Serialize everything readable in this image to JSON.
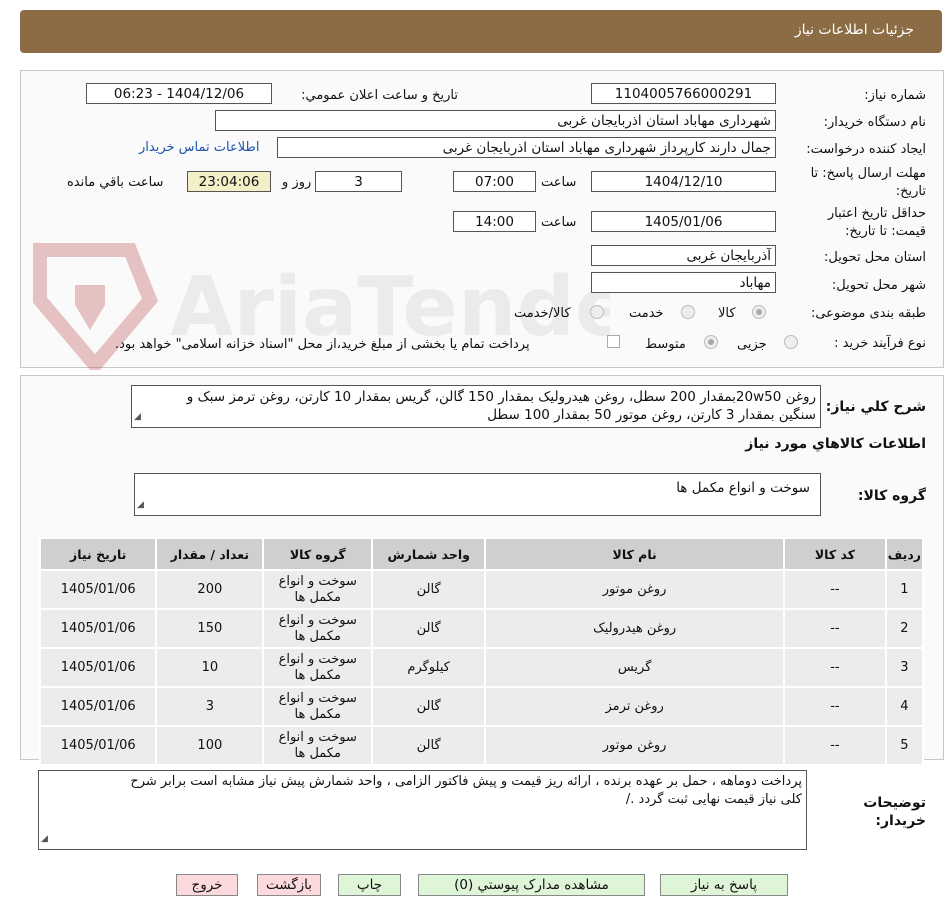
{
  "header": {
    "title": "جزئیات اطلاعات نیاز"
  },
  "watermark": "AriaTender.neT",
  "form": {
    "need_number_label": "شماره نیاز:",
    "need_number": "1104005766000291",
    "announce_label": "تاریخ و ساعت اعلان عمومي:",
    "announce_value": "1404/12/06 - 06:23",
    "buyer_org_label": "نام دستگاه خریدار:",
    "buyer_org": "شهرداری مهاباد استان اذربایجان غربی",
    "requester_label": "ایجاد کننده درخواست:",
    "requester": "جمال دارند کارپرداز  شهرداری مهاباد استان اذربایجان غربی",
    "contact_link": "اطلاعات تماس خریدار",
    "deadline_label_1": "مهلت ارسال پاسخ: تا",
    "deadline_label_2": "تاریخ:",
    "deadline_date": "1404/12/10",
    "time_label": "ساعت",
    "deadline_time": "07:00",
    "days_value": "3",
    "days_label": "روز و",
    "remaining_time": "23:04:06",
    "remaining_label": "ساعت باقي مانده",
    "validity_label_1": "حداقل تاريخ اعتبار",
    "validity_label_2": "قيمت: تا تاريخ:",
    "validity_date": "1405/01/06",
    "validity_time": "14:00",
    "province_label": "استان محل تحویل:",
    "province": "آذربایجان غربی",
    "city_label": "شهر محل تحویل:",
    "city": "مهاباد",
    "category_label": "طبقه بندی موضوعی:",
    "category_options": [
      "کالا",
      "خدمت",
      "کالا/خدمت"
    ],
    "process_label": "نوع فرآیند خرید :",
    "process_options": [
      "جزیی",
      "متوسط"
    ],
    "payment_note": "پرداخت تمام یا بخشی از مبلغ خرید،از محل \"اسناد خزانه اسلامی\" خواهد بود."
  },
  "summary": {
    "label": "شرح کلي نياز:",
    "line1": "روغن 20w50بمقدار 200 سطل، روغن هیدرولیک بمقدار 150 گالن، گریس بمقدار 10 کارتن، روغن ترمز سبک و",
    "line2": "سنگین بمقدار 3 کارتن، روغن موتور 50 بمقدار 100 سطل"
  },
  "goods": {
    "section_title": "اطلاعات کالاهاي مورد نياز",
    "group_label": "گروه کالا:",
    "group_value": "سوخت و انواع مکمل ها",
    "columns": [
      "رديف",
      "کد کالا",
      "نام کالا",
      "واحد شمارش",
      "گروه کالا",
      "تعداد / مقدار",
      "تاريخ نياز"
    ],
    "rows": [
      {
        "idx": "1",
        "code": "--",
        "name": "روغن موتور",
        "unit": "گالن",
        "group_1": "سوخت و انواع",
        "group_2": "مکمل ها",
        "qty": "200",
        "date": "1405/01/06"
      },
      {
        "idx": "2",
        "code": "--",
        "name": "روغن هیدرولیک",
        "unit": "گالن",
        "group_1": "سوخت و انواع",
        "group_2": "مکمل ها",
        "qty": "150",
        "date": "1405/01/06"
      },
      {
        "idx": "3",
        "code": "--",
        "name": "گریس",
        "unit": "کیلوگرم",
        "group_1": "سوخت و انواع",
        "group_2": "مکمل ها",
        "qty": "10",
        "date": "1405/01/06"
      },
      {
        "idx": "4",
        "code": "--",
        "name": "روغن ترمز",
        "unit": "گالن",
        "group_1": "سوخت و انواع",
        "group_2": "مکمل ها",
        "qty": "3",
        "date": "1405/01/06"
      },
      {
        "idx": "5",
        "code": "--",
        "name": "روغن موتور",
        "unit": "گالن",
        "group_1": "سوخت و انواع",
        "group_2": "مکمل ها",
        "qty": "100",
        "date": "1405/01/06"
      }
    ]
  },
  "notes": {
    "label_1": "توضیحات",
    "label_2": "خریدار:",
    "line1": "پرداخت دوماهه ، حمل بر عهده برنده ، ارائه ریز قیمت و پیش فاکتور الزامی ، واحد شمارش پیش نیاز مشابه است برابر شرح",
    "line2": "کلی نیاز قیمت نهایی ثبت گردد ./"
  },
  "buttons": {
    "reply": "پاسخ به نياز",
    "docs": "مشاهده مدارک پيوستي (0)",
    "print": "چاپ",
    "back": "بازگشت",
    "exit": "خروج"
  }
}
